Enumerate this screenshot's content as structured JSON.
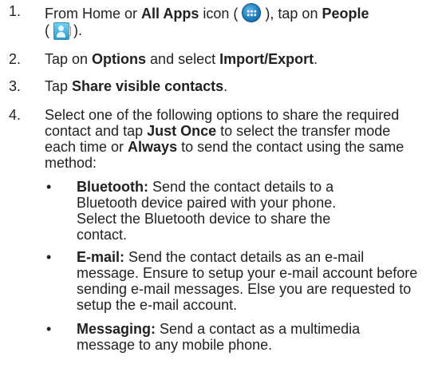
{
  "steps": [
    {
      "number": "1.",
      "parts": [
        {
          "text": "From Home or ",
          "bold": false
        },
        {
          "text": "All Apps",
          "bold": true
        },
        {
          "text": " icon ( ",
          "bold": false
        },
        {
          "icon": "all-apps-icon"
        },
        {
          "text": " ), tap on ",
          "bold": false
        },
        {
          "text": "People",
          "bold": true
        },
        {
          "text": " ( ",
          "bold": false
        },
        {
          "icon": "people-icon"
        },
        {
          "text": " ).",
          "bold": false
        }
      ]
    },
    {
      "number": "2.",
      "parts": [
        {
          "text": "Tap on ",
          "bold": false
        },
        {
          "text": "Options",
          "bold": true
        },
        {
          "text": " and select ",
          "bold": false
        },
        {
          "text": "Import/Export",
          "bold": true
        },
        {
          "text": ".",
          "bold": false
        }
      ]
    },
    {
      "number": "3.",
      "parts": [
        {
          "text": "Tap ",
          "bold": false
        },
        {
          "text": "Share visible contacts",
          "bold": true
        },
        {
          "text": ".",
          "bold": false
        }
      ]
    },
    {
      "number": "4.",
      "parts": [
        {
          "text": "Select one of the following options to share the required contact and tap ",
          "bold": false
        },
        {
          "text": "Just Once",
          "bold": true
        },
        {
          "text": " to select the transfer mode each time or ",
          "bold": false
        },
        {
          "text": "Always",
          "bold": true
        },
        {
          "text": " to send the contact using the same method:",
          "bold": false
        }
      ]
    }
  ],
  "bullet_char": "•",
  "bullets": [
    {
      "term": "Bluetooth:",
      "text": " Send the contact details to a Bluetooth device paired with your phone. Select the Bluetooth device to share the contact."
    },
    {
      "term": "E-mail:",
      "text": " Send the contact details as an e-mail message. Ensure to setup your e-mail account before sending e-mail messages. Else you are requested to setup the e-mail account."
    },
    {
      "term": "Messaging:",
      "text": " Send a contact as a multimedia message to any mobile phone."
    }
  ]
}
